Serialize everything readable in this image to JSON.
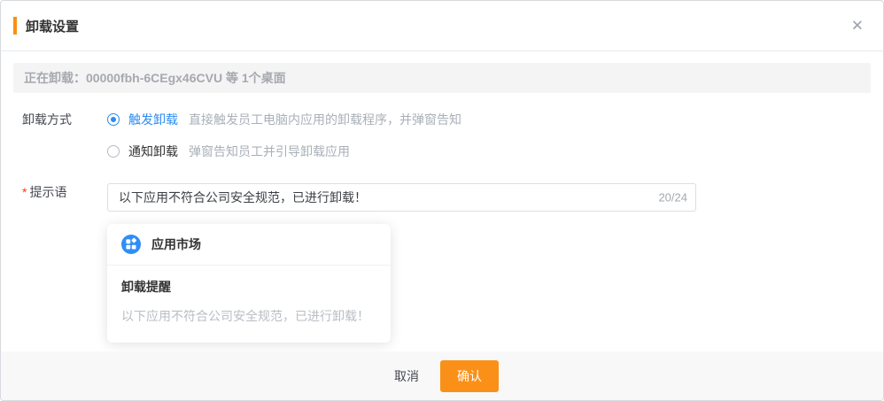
{
  "dialog": {
    "title": "卸载设置",
    "close_icon": "✕"
  },
  "info_bar": {
    "text": "正在卸载：00000fbh-6CEgx46CVU 等 1个桌面"
  },
  "form": {
    "method_label": "卸载方式",
    "options": [
      {
        "label": "触发卸载",
        "desc": "直接触发员工电脑内应用的卸载程序，并弹窗告知",
        "selected": true
      },
      {
        "label": "通知卸载",
        "desc": "弹窗告知员工并引导卸载应用",
        "selected": false
      }
    ],
    "required_mark": "*",
    "prompt_label": "提示语",
    "prompt_value": "以下应用不符合公司安全规范，已进行卸载！",
    "counter": "20/24"
  },
  "preview": {
    "app_name": "应用市场",
    "title": "卸载提醒",
    "message": "以下应用不符合公司安全规范，已进行卸载！"
  },
  "footer": {
    "cancel_label": "取消",
    "confirm_label": "确认"
  },
  "colors": {
    "accent_orange": "#fb9018",
    "primary_blue": "#2d8cf0",
    "info_bar_bg": "#f4f4f5",
    "footer_bg": "#f8f8f9"
  }
}
